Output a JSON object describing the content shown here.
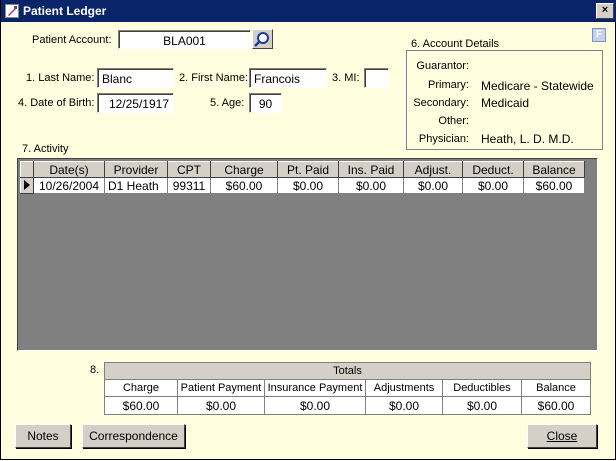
{
  "window": {
    "title": "Patient Ledger",
    "close_glyph": "×"
  },
  "header": {
    "account_label": "Patient Account:",
    "account_value": "BLA001",
    "last_name_label": "1. Last Name:",
    "last_name_value": "Blanc",
    "first_name_label": "2. First Name:",
    "first_name_value": "Francois",
    "mi_label": "3. MI:",
    "mi_value": "",
    "dob_label": "4. Date of Birth:",
    "dob_value": "12/25/1917",
    "age_label": "5. Age:",
    "age_value": "90"
  },
  "details": {
    "section_label": "6. Account Details",
    "f_button": "F",
    "guarantor_label": "Guarantor:",
    "guarantor_value": "",
    "primary_label": "Primary:",
    "primary_value": "Medicare - Statewide",
    "secondary_label": "Secondary:",
    "secondary_value": "Medicaid",
    "other_label": "Other:",
    "other_value": "",
    "physician_label": "Physician:",
    "physician_value": "Heath, L. D. M.D."
  },
  "activity": {
    "section_label": "7. Activity",
    "columns": [
      "Date(s)",
      "Provider",
      "CPT",
      "Charge",
      "Pt. Paid",
      "Ins. Paid",
      "Adjust.",
      "Deduct.",
      "Balance"
    ],
    "rows": [
      [
        "10/26/2004",
        "D1 Heath",
        "99311",
        "$60.00",
        "$0.00",
        "$0.00",
        "$0.00",
        "$0.00",
        "$60.00"
      ]
    ]
  },
  "totals": {
    "section_label": "8.",
    "title": "Totals",
    "columns": [
      "Charge",
      "Patient Payment",
      "Insurance Payment",
      "Adjustments",
      "Deductibles",
      "Balance"
    ],
    "values": [
      "$60.00",
      "$0.00",
      "$0.00",
      "$0.00",
      "$0.00",
      "$60.00"
    ]
  },
  "buttons": {
    "notes": "Notes",
    "correspondence": "Correspondence",
    "close": "Close"
  }
}
